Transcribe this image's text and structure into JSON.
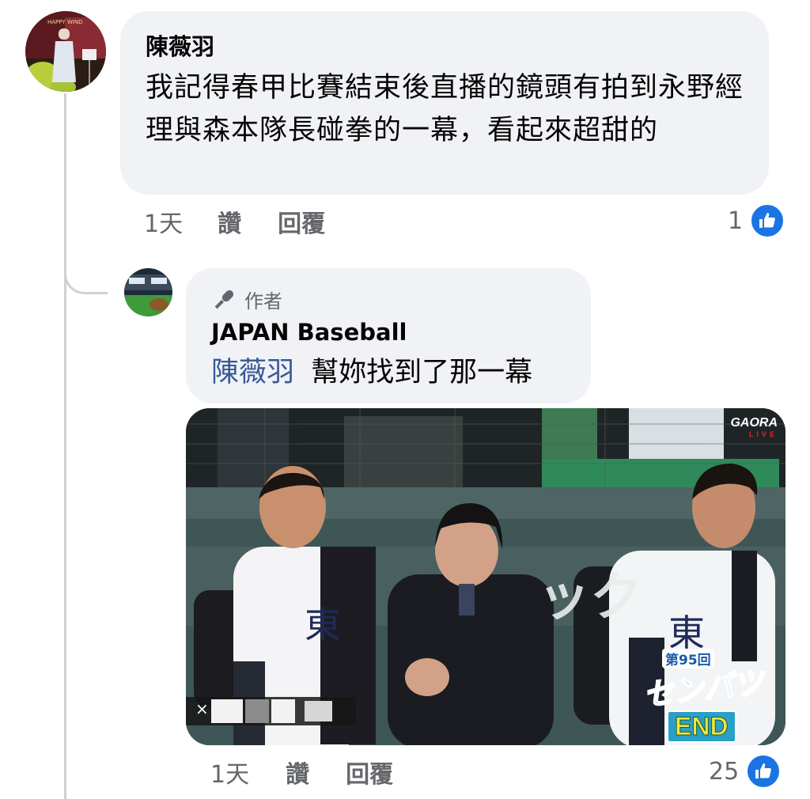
{
  "comment1": {
    "author": "陳薇羽",
    "text": "我記得春甲比賽結束後直播的鏡頭有拍到永野經理與森本隊長碰拳的一幕，看起來超甜的",
    "time": "1天",
    "like_label": "讚",
    "reply_label": "回覆",
    "reaction_count": "1",
    "avatar_text": "HAPPY WIND"
  },
  "reply1": {
    "author_badge": "作者",
    "author": "JAPAN Baseball",
    "mention": "陳薇羽",
    "text": "幫妳找到了那一幕",
    "time": "1天",
    "like_label": "讚",
    "reply_label": "回覆",
    "reaction_count": "25",
    "video": {
      "broadcaster": "GAORA",
      "broadcaster_sub": "LIVE",
      "banner_text": "ック",
      "event_line": "第95回",
      "event_name": "センバツ",
      "end_tag": "END",
      "caption_close": "×"
    }
  },
  "colors": {
    "bubble_bg": "#f0f2f5",
    "meta_text": "#65676b",
    "like_blue": "#1b74e4",
    "mention_blue": "#385898"
  }
}
